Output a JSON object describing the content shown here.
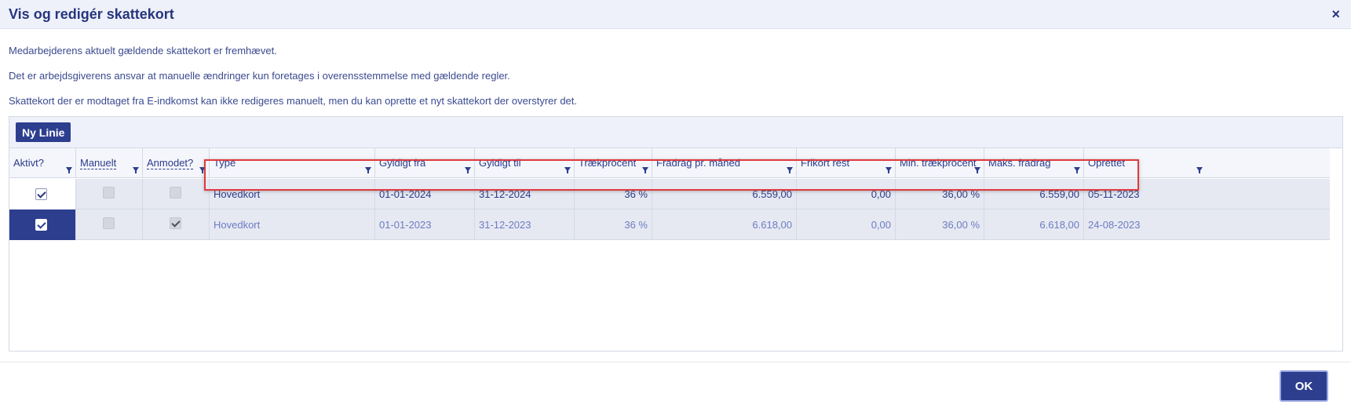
{
  "dialog": {
    "title": "Vis og redigér skattekort",
    "close_label": "×",
    "info_lines": [
      "Medarbejderens aktuelt gældende skattekort er fremhævet.",
      "Det er arbejdsgiverens ansvar at manuelle ændringer kun foretages i overensstemmelse med gældende regler.",
      "Skattekort der er modtaget fra E-indkomst kan ikke redigeres manuelt, men du kan oprette et nyt skattekort der overstyrer det."
    ],
    "ok_label": "OK"
  },
  "toolbar": {
    "new_line_label": "Ny Linie"
  },
  "table": {
    "columns": [
      "Aktivt?",
      "Manuelt",
      "Anmodet?",
      "Type",
      "Gyldigt fra",
      "Gyldigt til",
      "Trækprocent",
      "Fradrag pr. måned",
      "Frikort rest",
      "Min. trækprocent",
      "Maks. fradrag",
      "Oprettet"
    ],
    "rows": [
      {
        "aktivt": true,
        "manuelt": false,
        "anmodet": false,
        "type": "Hovedkort",
        "gyldigt_fra": "01-01-2024",
        "gyldigt_til": "31-12-2024",
        "traekprocent": "36 %",
        "fradrag": "6.559,00",
        "frikort_rest": "0,00",
        "min_traekprocent": "36,00 %",
        "maks_fradrag": "6.559,00",
        "oprettet": "05-11-2023",
        "highlighted": true
      },
      {
        "aktivt": true,
        "manuelt": false,
        "anmodet": true,
        "type": "Hovedkort",
        "gyldigt_fra": "01-01-2023",
        "gyldigt_til": "31-12-2023",
        "traekprocent": "36 %",
        "fradrag": "6.618,00",
        "frikort_rest": "0,00",
        "min_traekprocent": "36,00 %",
        "maks_fradrag": "6.618,00",
        "oprettet": "24-08-2023",
        "highlighted": false
      }
    ]
  },
  "colors": {
    "primary": "#2d3e8f",
    "text": "#2b3a8a",
    "muted_text": "#6d7cc4",
    "row_bg": "#e6e9f1",
    "highlight_border": "#e0393e"
  }
}
